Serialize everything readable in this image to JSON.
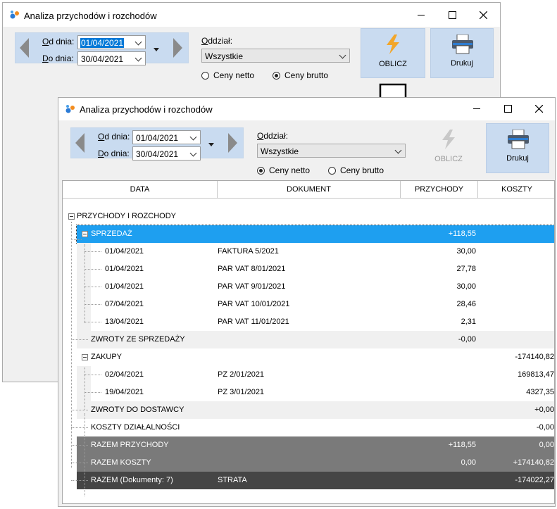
{
  "window": {
    "title": "Analiza przychodów i rozchodów"
  },
  "filters": {
    "from_label": "Od dnia:",
    "to_label": "Do dnia:",
    "branch_label": "Oddział:"
  },
  "back_window": {
    "from_date": "01/04/2021",
    "to_date": "30/04/2021",
    "branch": "Wszystkie",
    "radio_net": "Ceny netto",
    "radio_gross": "Ceny brutto",
    "selected_price": "gross",
    "calc_button": "OBLICZ",
    "print_button": "Drukuj"
  },
  "front_window": {
    "from_date": "01/04/2021",
    "to_date": "30/04/2021",
    "branch": "Wszystkie",
    "radio_net": "Ceny netto",
    "radio_gross": "Ceny brutto",
    "selected_price": "net",
    "calc_button": "OBLICZ",
    "print_button": "Drukuj",
    "columns": [
      "DATA",
      "DOKUMENT",
      "PRZYCHODY",
      "KOSZTY"
    ],
    "rows": [
      {
        "label": "PRZYCHODY I ROZCHODY",
        "doc": "",
        "income": "",
        "cost": ""
      },
      {
        "label": "SPRZEDAŻ",
        "doc": "",
        "income": "+118,55",
        "cost": ""
      },
      {
        "label": "01/04/2021",
        "doc": "FAKTURA 5/2021",
        "income": "30,00",
        "cost": ""
      },
      {
        "label": "01/04/2021",
        "doc": "PAR VAT 8/01/2021",
        "income": "27,78",
        "cost": ""
      },
      {
        "label": "01/04/2021",
        "doc": "PAR VAT 9/01/2021",
        "income": "30,00",
        "cost": ""
      },
      {
        "label": "07/04/2021",
        "doc": "PAR VAT 10/01/2021",
        "income": "28,46",
        "cost": ""
      },
      {
        "label": "13/04/2021",
        "doc": "PAR VAT 11/01/2021",
        "income": "2,31",
        "cost": ""
      },
      {
        "label": "ZWROTY ZE SPRZEDAŻY",
        "doc": "",
        "income": "-0,00",
        "cost": ""
      },
      {
        "label": "ZAKUPY",
        "doc": "",
        "income": "",
        "cost": "-174140,82"
      },
      {
        "label": "02/04/2021",
        "doc": "PZ 2/01/2021",
        "income": "",
        "cost": "169813,47"
      },
      {
        "label": "19/04/2021",
        "doc": "PZ 3/01/2021",
        "income": "",
        "cost": "4327,35"
      },
      {
        "label": "ZWROTY DO DOSTAWCY",
        "doc": "",
        "income": "",
        "cost": "+0,00"
      },
      {
        "label": "KOSZTY DZIAŁALNOŚCI",
        "doc": "",
        "income": "",
        "cost": "-0,00"
      },
      {
        "label": "RAZEM PRZYCHODY",
        "doc": "",
        "income": "+118,55",
        "cost": "0,00"
      },
      {
        "label": "RAZEM KOSZTY",
        "doc": "",
        "income": "0,00",
        "cost": "+174140,82"
      },
      {
        "label": "RAZEM (Dokumenty: 7)",
        "doc": "STRATA",
        "income": "",
        "cost": "-174022,27"
      }
    ]
  },
  "colors": {
    "selected_row": "#1e9ff0",
    "summary_row": "#7a7a7a",
    "total_row": "#454545",
    "button_bg": "#c9dbf0"
  }
}
